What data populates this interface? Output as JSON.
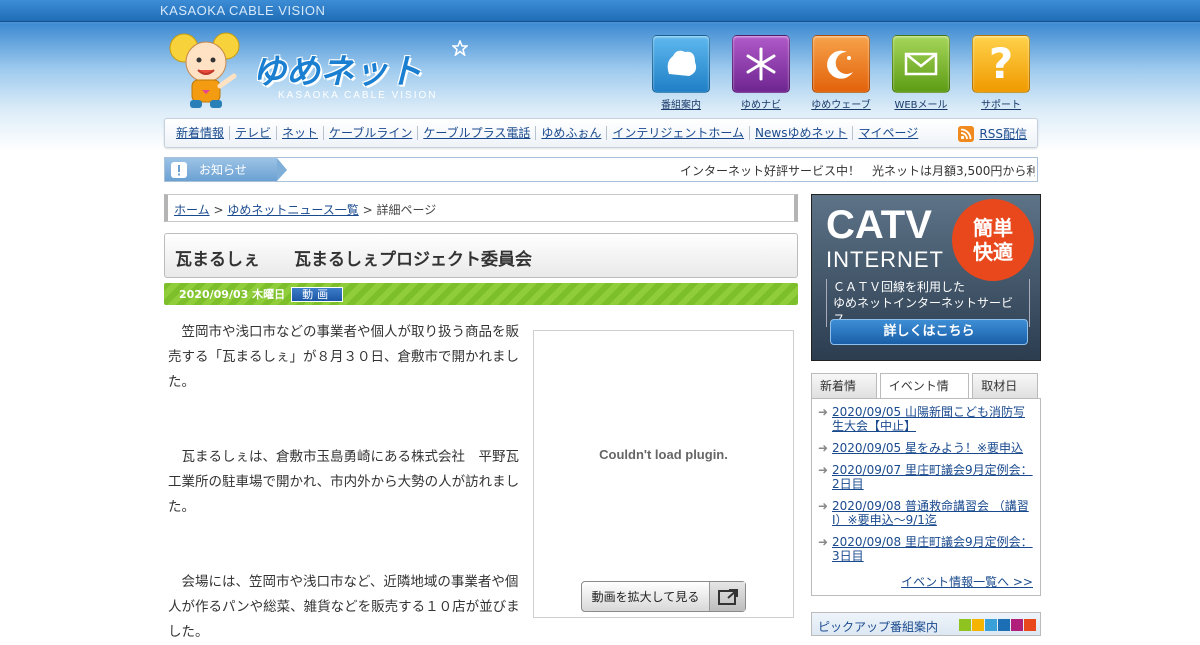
{
  "top_brand": "KASAOKA CABLE VISION",
  "logo": {
    "text": "ゆめネット",
    "sub": "KASAOKA CABLE VISION"
  },
  "services": [
    {
      "label": "番組案内",
      "icon": "tv-guide-icon",
      "color": "#1f8fd6"
    },
    {
      "label": "ゆめナビ",
      "icon": "asterisk-icon",
      "color": "#8a3aa8"
    },
    {
      "label": "ゆめウェーブ",
      "icon": "crescent-icon",
      "color": "#ee7a16"
    },
    {
      "label": "WEBメール",
      "icon": "mail-icon",
      "color": "#7fb82a"
    },
    {
      "label": "サポート",
      "icon": "question-icon",
      "color": "#f0a800"
    }
  ],
  "nav": {
    "items": [
      "新着情報",
      "テレビ",
      "ネット",
      "ケーブルライン",
      "ケーブルプラス電話",
      "ゆめふぉん",
      "インテリジェントホーム",
      "Newsゆめネット",
      "マイページ"
    ],
    "rss": "RSS配信"
  },
  "notice": {
    "tag": "お知らせ",
    "message": "インターネット好評サービス中！　光ネットは月額3,500円から利用"
  },
  "breadcrumb": {
    "home": "ホーム",
    "sep1": ">",
    "list": "ゆめネットニュース一覧",
    "sep2": ">",
    "current": "詳細ページ"
  },
  "article": {
    "title": "瓦まるしぇ　　瓦まるしぇプロジェクト委員会",
    "date": "2020/09/03 木曜日",
    "badge": "動画",
    "paragraphs": [
      "笠岡市や浅口市などの事業者や個人が取り扱う商品を販売する「瓦まるしぇ」が８月３０日、倉敷市で開かれました。",
      "瓦まるしぇは、倉敷市玉島勇崎にある株式会社　平野瓦工業所の駐車場で開かれ、市内外から大勢の人が訪れました。",
      "会場には、笠岡市や浅口市など、近隣地域の事業者や個人が作るパンや総菜、雑貨などを販売する１０店が並びました。"
    ]
  },
  "player": {
    "error": "Couldn't load plugin.",
    "expand_label": "動画を拡大して見る"
  },
  "banner": {
    "catv": "CATV",
    "internet": "INTERNET",
    "burst": "簡単快適",
    "burst_l1": "簡単",
    "burst_l2": "快適",
    "desc1": "ＣＡＴＶ回線を利用した",
    "desc2": "ゆめネットインターネットサービス",
    "more": "詳しくはこちら"
  },
  "tabs": [
    "新着情報",
    "イベント情報",
    "取材日記"
  ],
  "events": [
    "2020/09/05 山陽新聞こども消防写生大会【中止】",
    "2020/09/05 星をみよう！※要申込",
    "2020/09/07 里庄町議会9月定例会：2日目",
    "2020/09/08 普通救命講習会 （講習Ⅰ）※要申込～9/1迄",
    "2020/09/08 里庄町議会9月定例会：3日目"
  ],
  "events_all": "イベント情報一覧へ >>",
  "pickup": {
    "label": "ピックアップ番組案内",
    "chips": [
      "#8fc31f",
      "#f5b400",
      "#3aa0d8",
      "#1d6fb5",
      "#b0207a",
      "#e8481c"
    ]
  }
}
